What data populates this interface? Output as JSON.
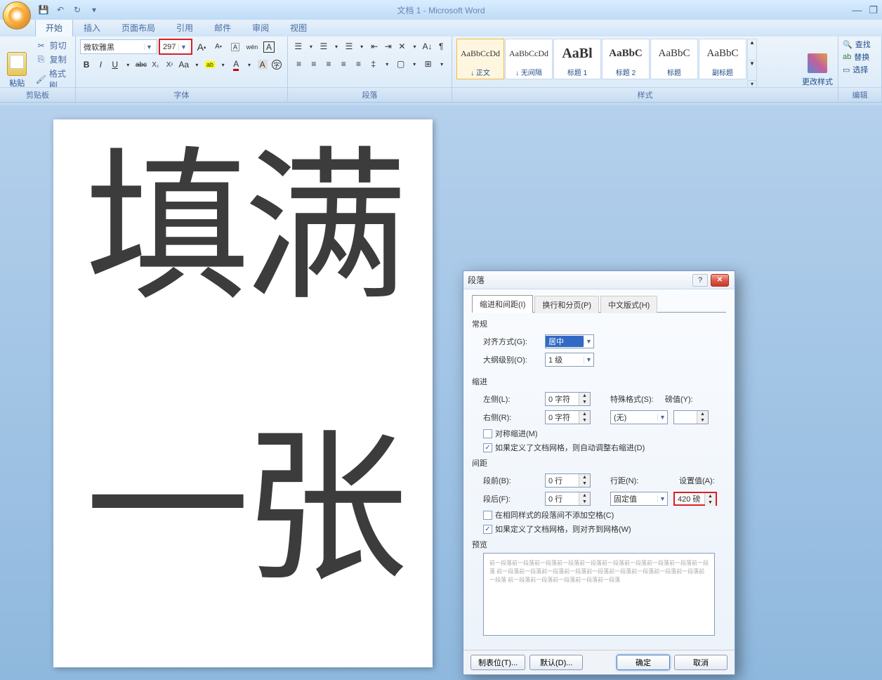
{
  "title": "文档 1 - Microsoft Word",
  "qat": {
    "save": "💾",
    "undo": "↶",
    "redo": "↻"
  },
  "tabs": [
    "开始",
    "插入",
    "页面布局",
    "引用",
    "邮件",
    "审阅",
    "视图"
  ],
  "clipboard": {
    "paste_label": "粘贴",
    "cut": "剪切",
    "copy": "复制",
    "format_painter": "格式刷",
    "group": "剪贴板"
  },
  "font": {
    "name": "微软雅黑",
    "size": "297",
    "group": "字体",
    "grow": "A",
    "shrink": "A",
    "bold": "B",
    "italic": "I",
    "underline": "U",
    "strike": "abc",
    "sub": "X₂",
    "sup": "X²",
    "case": "Aa",
    "clear": "Aᵡ"
  },
  "para": {
    "group": "段落"
  },
  "styles": {
    "group": "样式",
    "change": "更改样式",
    "items": [
      {
        "preview": "AaBbCcDd",
        "name": "↓ 正文"
      },
      {
        "preview": "AaBbCcDd",
        "name": "↓ 无间隔"
      },
      {
        "preview": "AaBl",
        "name": "标题 1"
      },
      {
        "preview": "AaBbC",
        "name": "标题 2"
      },
      {
        "preview": "AaBbC",
        "name": "标题"
      },
      {
        "preview": "AaBbC",
        "name": "副标题"
      }
    ]
  },
  "edit": {
    "group": "编辑",
    "find": "查找",
    "replace": "替换",
    "select": "选择"
  },
  "page_content": {
    "line1": "填满",
    "line2": "一张"
  },
  "dialog": {
    "title": "段落",
    "tabs": [
      "缩进和间距(I)",
      "换行和分页(P)",
      "中文版式(H)"
    ],
    "general": {
      "section": "常规",
      "alignment_label": "对齐方式(G):",
      "alignment_value": "居中",
      "outline_label": "大纲级别(O):",
      "outline_value": "1 级"
    },
    "indent": {
      "section": "缩进",
      "left_label": "左侧(L):",
      "left_value": "0 字符",
      "right_label": "右侧(R):",
      "right_value": "0 字符",
      "special_label": "特殊格式(S):",
      "special_value": "(无)",
      "by_label": "磅值(Y):",
      "mirror": "对称缩进(M)",
      "autoAdjust": "如果定义了文档网格，则自动调整右缩进(D)"
    },
    "spacing": {
      "section": "间距",
      "before_label": "段前(B):",
      "before_value": "0 行",
      "after_label": "段后(F):",
      "after_value": "0 行",
      "line_label": "行距(N):",
      "line_value": "固定值",
      "at_label": "设置值(A):",
      "at_value": "420 磅",
      "noSpace": "在相同样式的段落间不添加空格(C)",
      "snapGrid": "如果定义了文档网格，则对齐到网格(W)"
    },
    "preview": {
      "section": "预览",
      "text": "前一段落前一段落前一段落前一段落前一段落前一段落前一段落前一段落前一段落前一段落\n前一段落前一段落前一段落前一段落前一段落前一段落前一段落前一段落前一段落前一段落\n前一段落前一段落前一段落前一段落前一段落"
    },
    "buttons": {
      "tabs": "制表位(T)...",
      "default": "默认(D)...",
      "ok": "确定",
      "cancel": "取消"
    }
  }
}
